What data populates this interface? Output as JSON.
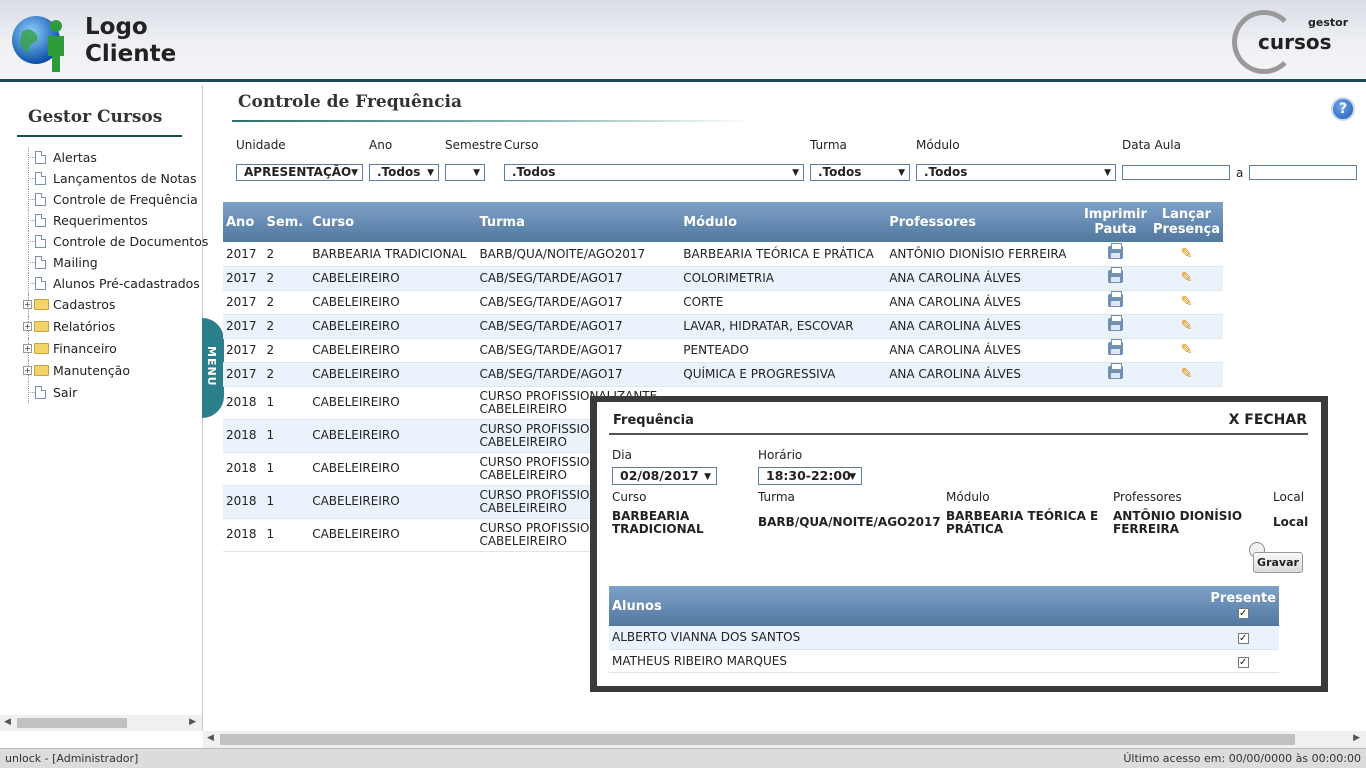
{
  "header": {
    "logo_line1": "Logo",
    "logo_line2": "Cliente",
    "brand_small": "gestor",
    "brand_big": "cursos"
  },
  "sidebar": {
    "title": "Gestor Cursos",
    "items": [
      {
        "label": "Alertas",
        "type": "doc"
      },
      {
        "label": "Lançamentos de Notas",
        "type": "doc"
      },
      {
        "label": "Controle de Frequência",
        "type": "doc"
      },
      {
        "label": "Requerimentos",
        "type": "doc"
      },
      {
        "label": "Controle de Documentos",
        "type": "doc"
      },
      {
        "label": "Mailing",
        "type": "doc"
      },
      {
        "label": "Alunos Pré-cadastrados",
        "type": "doc"
      },
      {
        "label": "Cadastros",
        "type": "folder"
      },
      {
        "label": "Relatórios",
        "type": "folder"
      },
      {
        "label": "Financeiro",
        "type": "folder"
      },
      {
        "label": "Manutenção",
        "type": "folder"
      },
      {
        "label": "Sair",
        "type": "doc"
      }
    ],
    "menu_tab": "MENU"
  },
  "main": {
    "title": "Controle de Frequência",
    "help": "?",
    "filters": {
      "unidade_label": "Unidade",
      "unidade_value": "APRESENTAÇÃO",
      "ano_label": "Ano",
      "ano_value": ".Todos",
      "semestre_label": "Semestre",
      "semestre_value": "",
      "curso_label": "Curso",
      "curso_value": ".Todos",
      "turma_label": "Turma",
      "turma_value": ".Todos",
      "modulo_label": "Módulo",
      "modulo_value": ".Todos",
      "data_label": "Data Aula",
      "data_sep": "a"
    },
    "table": {
      "headers": {
        "ano": "Ano",
        "sem": "Sem.",
        "curso": "Curso",
        "turma": "Turma",
        "modulo": "Módulo",
        "professores": "Professores",
        "imprimir1": "Imprimir",
        "imprimir2": "Pauta",
        "lancar1": "Lançar",
        "lancar2": "Presença"
      },
      "rows": [
        {
          "ano": "2017",
          "sem": "2",
          "curso": "BARBEARIA TRADICIONAL",
          "turma": "BARB/QUA/NOITE/AGO2017",
          "turma2": "",
          "modulo": "BARBEARIA TEÓRICA E PRÁTICA",
          "prof": "ANTÔNIO DIONÍSIO FERREIRA"
        },
        {
          "ano": "2017",
          "sem": "2",
          "curso": "CABELEIREIRO",
          "turma": "CAB/SEG/TARDE/AGO17",
          "turma2": "",
          "modulo": "COLORIMETRIA",
          "prof": "ANA CAROLINA ÁLVES"
        },
        {
          "ano": "2017",
          "sem": "2",
          "curso": "CABELEIREIRO",
          "turma": "CAB/SEG/TARDE/AGO17",
          "turma2": "",
          "modulo": "CORTE",
          "prof": "ANA CAROLINA ÁLVES"
        },
        {
          "ano": "2017",
          "sem": "2",
          "curso": "CABELEIREIRO",
          "turma": "CAB/SEG/TARDE/AGO17",
          "turma2": "",
          "modulo": "LAVAR, HIDRATAR, ESCOVAR",
          "prof": "ANA CAROLINA ÁLVES"
        },
        {
          "ano": "2017",
          "sem": "2",
          "curso": "CABELEIREIRO",
          "turma": "CAB/SEG/TARDE/AGO17",
          "turma2": "",
          "modulo": "PENTEADO",
          "prof": "ANA CAROLINA ÁLVES"
        },
        {
          "ano": "2017",
          "sem": "2",
          "curso": "CABELEIREIRO",
          "turma": "CAB/SEG/TARDE/AGO17",
          "turma2": "",
          "modulo": "QUÍMICA E PROGRESSIVA",
          "prof": "ANA CAROLINA ÁLVES"
        },
        {
          "ano": "2018",
          "sem": "1",
          "curso": "CABELEIREIRO",
          "turma": "CURSO PROFISSIONALIZANTE",
          "turma2": "CABELEIREIRO",
          "modulo": "",
          "prof": ""
        },
        {
          "ano": "2018",
          "sem": "1",
          "curso": "CABELEIREIRO",
          "turma": "CURSO PROFISSION",
          "turma2": "CABELEIREIRO",
          "modulo": "",
          "prof": ""
        },
        {
          "ano": "2018",
          "sem": "1",
          "curso": "CABELEIREIRO",
          "turma": "CURSO PROFISSION",
          "turma2": "CABELEIREIRO",
          "modulo": "",
          "prof": ""
        },
        {
          "ano": "2018",
          "sem": "1",
          "curso": "CABELEIREIRO",
          "turma": "CURSO PROFISSION",
          "turma2": "CABELEIREIRO",
          "modulo": "",
          "prof": ""
        },
        {
          "ano": "2018",
          "sem": "1",
          "curso": "CABELEIREIRO",
          "turma": "CURSO PROFISSION",
          "turma2": "CABELEIREIRO",
          "modulo": "",
          "prof": ""
        }
      ]
    }
  },
  "modal": {
    "title": "Frequência",
    "close": "X FECHAR",
    "dia_label": "Dia",
    "dia_value": "02/08/2017",
    "horario_label": "Horário",
    "horario_value": "18:30-22:00",
    "curso_label": "Curso",
    "curso_value": "BARBEARIA TRADICIONAL",
    "turma_label": "Turma",
    "turma_value": "BARB/QUA/NOITE/AGO2017",
    "modulo_label": "Módulo",
    "modulo_value": "BARBEARIA TEÓRICA E PRÁTICA",
    "prof_label": "Professores",
    "prof_value": "ANTÔNIO DIONÍSIO FERREIRA",
    "local_label": "Local",
    "local_value": "Local",
    "gravar": "Gravar",
    "alunos_header": "Alunos",
    "presente_header": "Presente",
    "alunos": [
      {
        "nome": "ALBERTO VIANNA DOS SANTOS",
        "presente": true
      },
      {
        "nome": "MATHEUS RIBEIRO MARQUES",
        "presente": true
      }
    ]
  },
  "status": {
    "left": "unlock - [Administrador]",
    "right": "Último acesso em: 00/00/0000  às 00:00:00"
  }
}
